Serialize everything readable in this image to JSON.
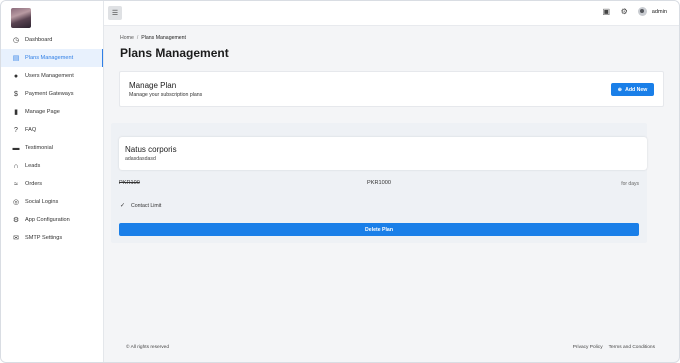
{
  "topbar": {
    "user_name": "admin"
  },
  "sidebar": {
    "items": [
      {
        "label": "Dashboard",
        "icon": "dashboard-icon",
        "glyph": "◷"
      },
      {
        "label": "Plans Management",
        "icon": "document-icon",
        "glyph": "▤"
      },
      {
        "label": "Users Management",
        "icon": "user-icon",
        "glyph": "●"
      },
      {
        "label": "Payment Gateways",
        "icon": "dollar-icon",
        "glyph": "$"
      },
      {
        "label": "Manage Page",
        "icon": "book-icon",
        "glyph": "▮"
      },
      {
        "label": "FAQ",
        "icon": "question-icon",
        "glyph": "?"
      },
      {
        "label": "Testimonial",
        "icon": "quote-icon",
        "glyph": "▬"
      },
      {
        "label": "Leads",
        "icon": "headset-icon",
        "glyph": "∩"
      },
      {
        "label": "Orders",
        "icon": "orders-icon",
        "glyph": "≈"
      },
      {
        "label": "Social Logins",
        "icon": "globe-icon",
        "glyph": "◎"
      },
      {
        "label": "App Configuration",
        "icon": "gear-icon",
        "glyph": "⚙"
      },
      {
        "label": "SMTP Settings",
        "icon": "mail-icon",
        "glyph": "✉"
      }
    ],
    "active_index": 1
  },
  "breadcrumb": {
    "home": "Home",
    "separator": "/",
    "current": "Plans Management"
  },
  "page": {
    "title": "Plans Management"
  },
  "manage_card": {
    "title": "Manage Plan",
    "subtitle": "Manage your subscription plans",
    "add_button": "Add New"
  },
  "plan": {
    "name": "Natus corporis",
    "description": "adasdasdasd",
    "old_price": "PKR100",
    "price": "PKR1000",
    "duration": "for days",
    "features": [
      "Contact Limit"
    ],
    "delete_button": "Delete Plan"
  },
  "footer": {
    "copyright": "© All rights reserved",
    "privacy": "Privacy Policy",
    "terms": "Terms and Conditions"
  },
  "colors": {
    "accent": "#1a7fe8",
    "active_bg": "#e8f1fd"
  }
}
